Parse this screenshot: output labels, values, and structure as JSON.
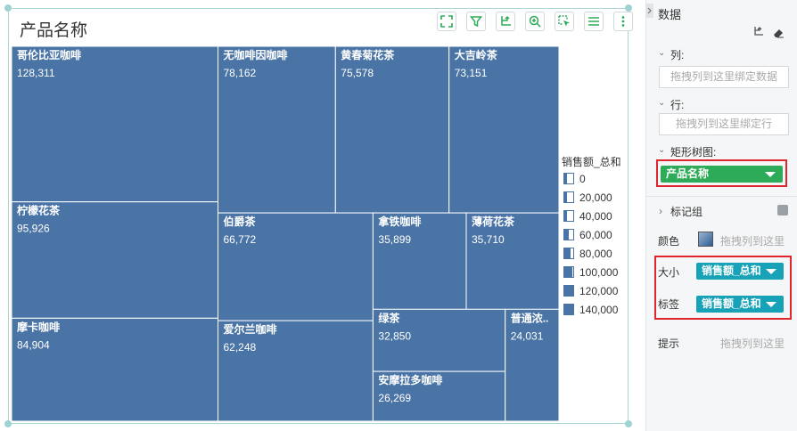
{
  "chart_data": {
    "type": "treemap",
    "title": "产品名称",
    "items": [
      {
        "label": "哥伦比亚咖啡",
        "value": 128311
      },
      {
        "label": "柠檬花茶",
        "value": 95926
      },
      {
        "label": "摩卡咖啡",
        "value": 84904
      },
      {
        "label": "无咖啡因咖啡",
        "value": 78162
      },
      {
        "label": "黄春菊花茶",
        "value": 75578
      },
      {
        "label": "大吉岭茶",
        "value": 73151
      },
      {
        "label": "伯爵茶",
        "value": 66772
      },
      {
        "label": "爱尔兰咖啡",
        "value": 62248
      },
      {
        "label": "拿铁咖啡",
        "value": 35899
      },
      {
        "label": "薄荷花茶",
        "value": 35710
      },
      {
        "label": "绿茶",
        "value": 32850
      },
      {
        "label": "安摩拉多咖啡",
        "value": 26269
      },
      {
        "label": "普通浓..",
        "value": 24031
      }
    ],
    "legend": {
      "title": "销售额_总和",
      "entries": [
        "0",
        "20,000",
        "40,000",
        "60,000",
        "80,000",
        "100,000",
        "120,000",
        "140,000"
      ],
      "levels": [
        0,
        20000,
        40000,
        60000,
        80000,
        100000,
        120000,
        140000
      ],
      "max": 140000,
      "placement": "right"
    },
    "color": "#4a74a6"
  },
  "toolbar": {
    "icons": [
      "expand-icon",
      "filter-icon",
      "drill-icon",
      "zoom-icon",
      "select-icon",
      "list-icon",
      "more-icon"
    ]
  },
  "panel": {
    "title": "数据",
    "columns_label": "列:",
    "columns_hint": "拖拽列到这里绑定数据",
    "rows_label": "行:",
    "rows_hint": "拖拽列到这里绑定行",
    "treemap_label": "矩形树图:",
    "treemap_field": "产品名称",
    "marks_label": "标记组",
    "color_label": "颜色",
    "color_hint": "拖拽列到这里",
    "size_label": "大小",
    "size_field": "销售额_总和",
    "label_label": "标签",
    "label_field": "销售额_总和",
    "tooltip_label": "提示",
    "tooltip_hint": "拖拽列到这里",
    "colors": {
      "green_pill": "#2eab58",
      "teal_pill": "#17a2b8",
      "highlight": "#e0262d"
    }
  }
}
